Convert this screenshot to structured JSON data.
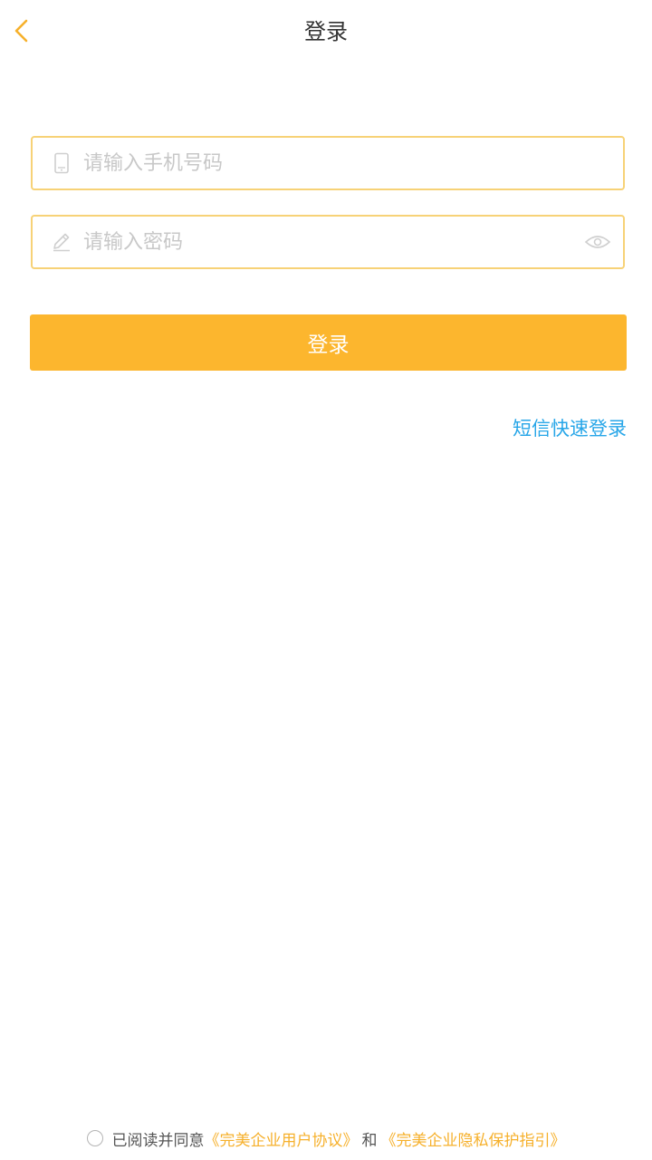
{
  "header": {
    "title": "登录",
    "back_icon": "chevron-left-icon"
  },
  "form": {
    "phone": {
      "placeholder": "请输入手机号码",
      "value": "",
      "icon": "phone-icon"
    },
    "password": {
      "placeholder": "请输入密码",
      "value": "",
      "icon": "pencil-icon",
      "toggle_icon": "eye-icon"
    },
    "login_label": "登录",
    "sms_login_label": "短信快速登录"
  },
  "agreement": {
    "prefix": "已阅读并同意",
    "user_agreement": "《完美企业用户协议》",
    "and": "和",
    "privacy_guide": "《完美企业隐私保护指引》"
  },
  "colors": {
    "accent": "#fcb62e",
    "field_border": "#f7d277",
    "link_blue": "#27a6e8",
    "agreement_link": "#f6b02b"
  }
}
